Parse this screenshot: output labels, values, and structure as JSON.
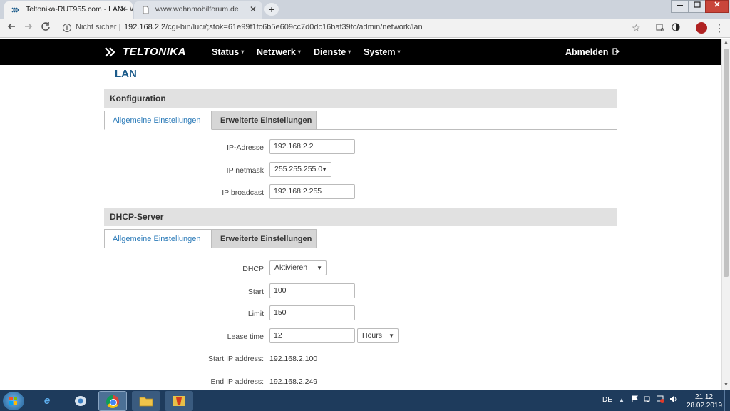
{
  "browser": {
    "tabs": [
      {
        "title": "Teltonika-RUT955.com - LAN - W",
        "active": true
      },
      {
        "title": "www.wohnmobilforum.de",
        "active": false
      }
    ],
    "new_tab": "+",
    "close_symbol": "✕",
    "security_label": "Nicht sicher",
    "url_host": "192.168.2.2",
    "url_path": "/cgi-bin/luci/;stok=61e99f1fc6b5e609cc7d0dc16baf39fc/admin/network/lan",
    "extension_badge": "0"
  },
  "app": {
    "brand": "TELTONIKA",
    "nav": [
      {
        "label": "Status"
      },
      {
        "label": "Netzwerk"
      },
      {
        "label": "Dienste"
      },
      {
        "label": "System"
      }
    ],
    "logout_label": "Abmelden"
  },
  "page": {
    "title": "LAN",
    "config": {
      "heading": "Konfiguration",
      "tabs": [
        "Allgemeine Einstellungen",
        "Erweiterte Einstellungen"
      ],
      "fields": [
        {
          "label": "IP-Adresse",
          "value": "192.168.2.2"
        },
        {
          "label": "IP netmask",
          "value": "255.255.255.0"
        },
        {
          "label": "IP broadcast",
          "value": "192.168.2.255"
        }
      ]
    },
    "dhcp": {
      "heading": "DHCP-Server",
      "tabs": [
        "Allgemeine Einstellungen",
        "Erweiterte Einstellungen"
      ],
      "fields": [
        {
          "label": "DHCP",
          "value": "Aktivieren"
        },
        {
          "label": "Start",
          "value": "100"
        },
        {
          "label": "Limit",
          "value": "150"
        },
        {
          "label": "Lease time",
          "value": "12",
          "unit": "Hours"
        },
        {
          "label": "Start IP address:",
          "value": "192.168.2.100"
        },
        {
          "label": "End IP address:",
          "value": "192.168.2.249"
        }
      ]
    }
  },
  "taskbar": {
    "language": "DE",
    "time": "21:12",
    "date": "28.02.2019"
  },
  "icons": {
    "dropdown": "▼",
    "caret": "▾"
  }
}
